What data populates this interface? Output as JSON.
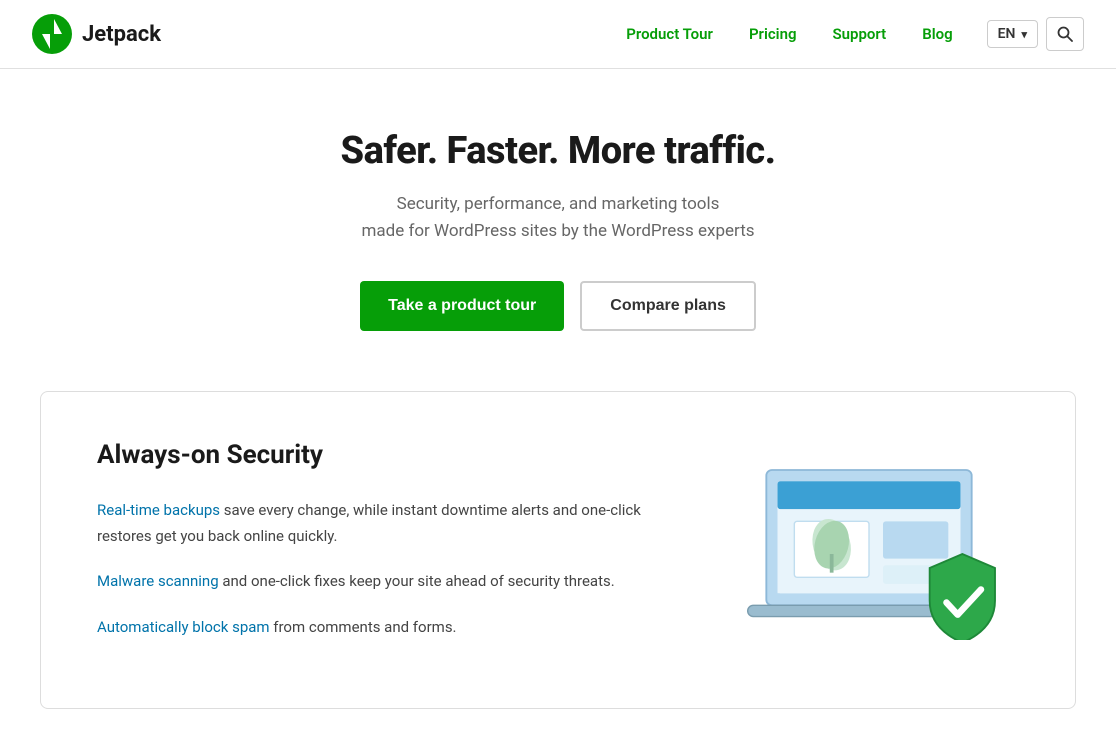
{
  "header": {
    "logo_text": "Jetpack",
    "nav": {
      "items": [
        {
          "label": "Product Tour",
          "id": "product-tour"
        },
        {
          "label": "Pricing",
          "id": "pricing"
        },
        {
          "label": "Support",
          "id": "support"
        },
        {
          "label": "Blog",
          "id": "blog"
        }
      ]
    },
    "lang_label": "EN",
    "search_icon": "🔍"
  },
  "hero": {
    "title": "Safer. Faster. More traffic.",
    "subtitle_line1": "Security, performance, and marketing tools",
    "subtitle_line2": "made for WordPress sites by the WordPress experts",
    "btn_primary": "Take a product tour",
    "btn_secondary": "Compare plans"
  },
  "security_card": {
    "title": "Always-on Security",
    "paragraphs": [
      {
        "link_text": "Real-time backups",
        "rest": " save every change, while instant downtime alerts and one-click restores get you back online quickly."
      },
      {
        "link_text": "Malware scanning",
        "rest": " and one-click fixes keep your site ahead of security threats."
      },
      {
        "link_text": "Automatically block spam",
        "rest": " from comments and forms."
      }
    ]
  }
}
